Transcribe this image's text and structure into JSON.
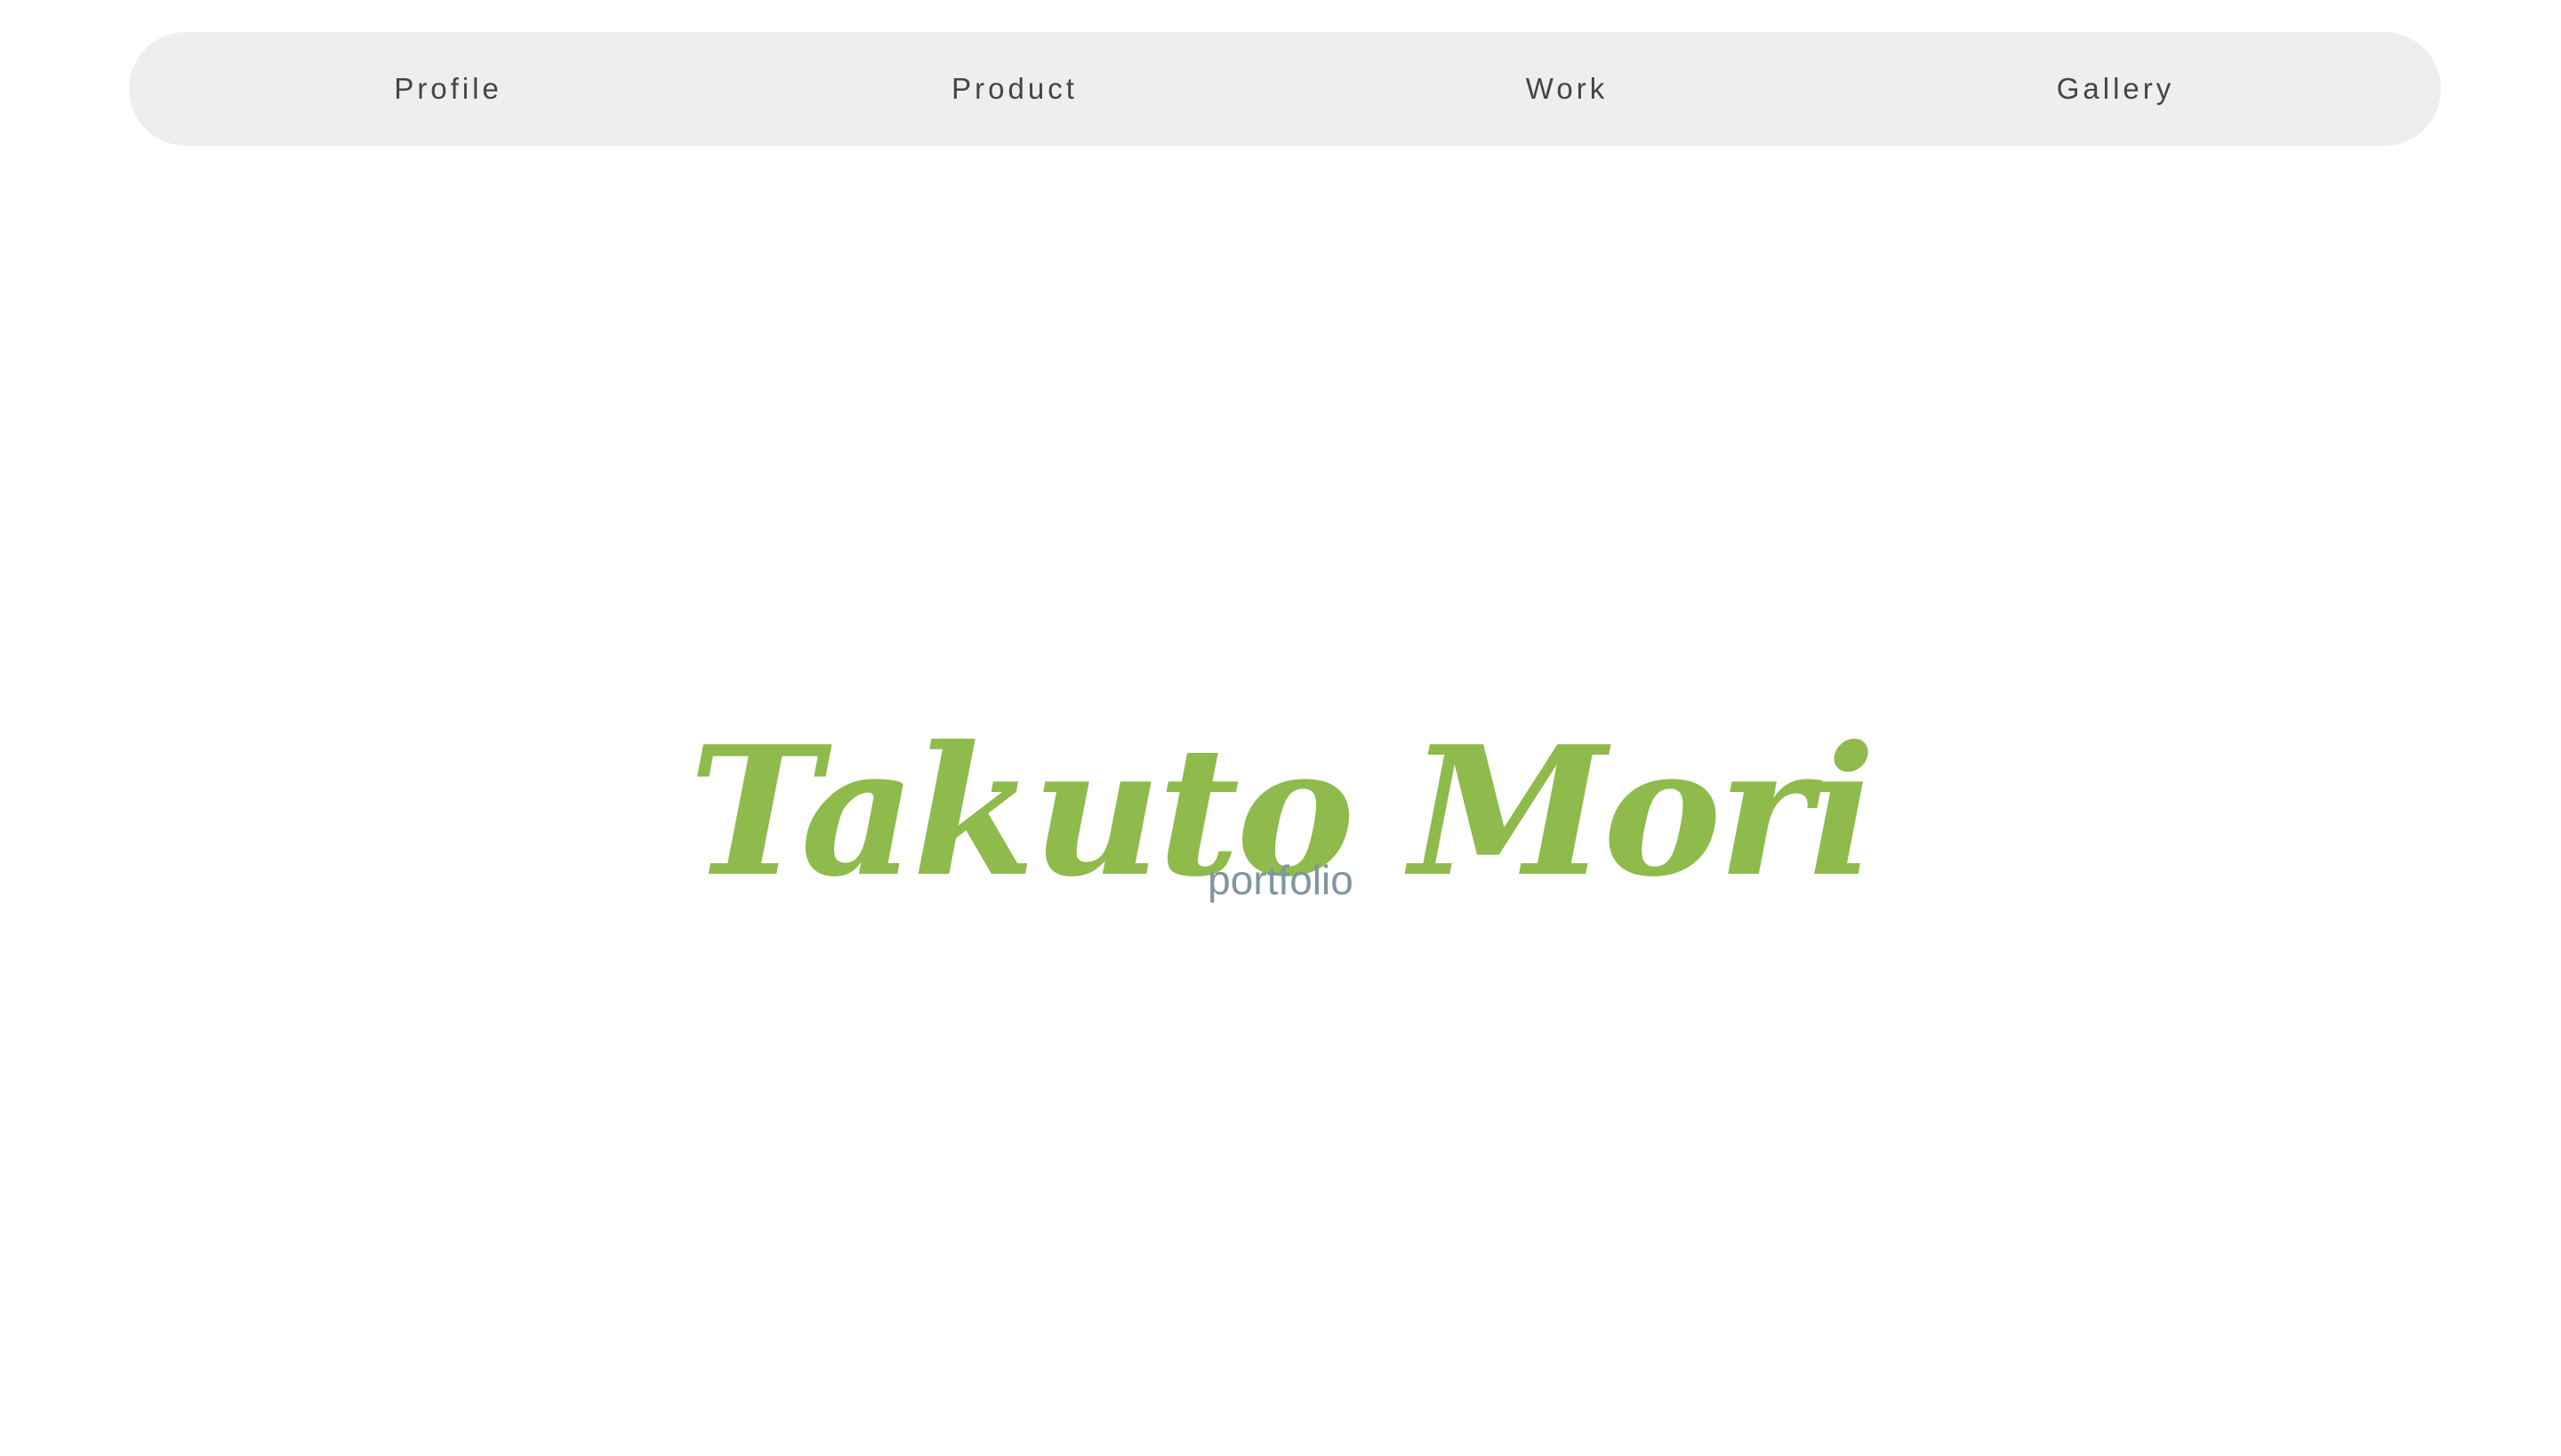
{
  "nav": {
    "items": [
      {
        "label": "Profile"
      },
      {
        "label": "Product"
      },
      {
        "label": "Work"
      },
      {
        "label": "Gallery"
      }
    ]
  },
  "hero": {
    "title": "Takuto Mori",
    "subtitle": "portfolio"
  },
  "colors": {
    "title": "#8fba4c",
    "subtitle": "#7f95a0",
    "nav_background": "#eeeeee",
    "nav_text": "#444444",
    "page_background": "#ffffff"
  }
}
